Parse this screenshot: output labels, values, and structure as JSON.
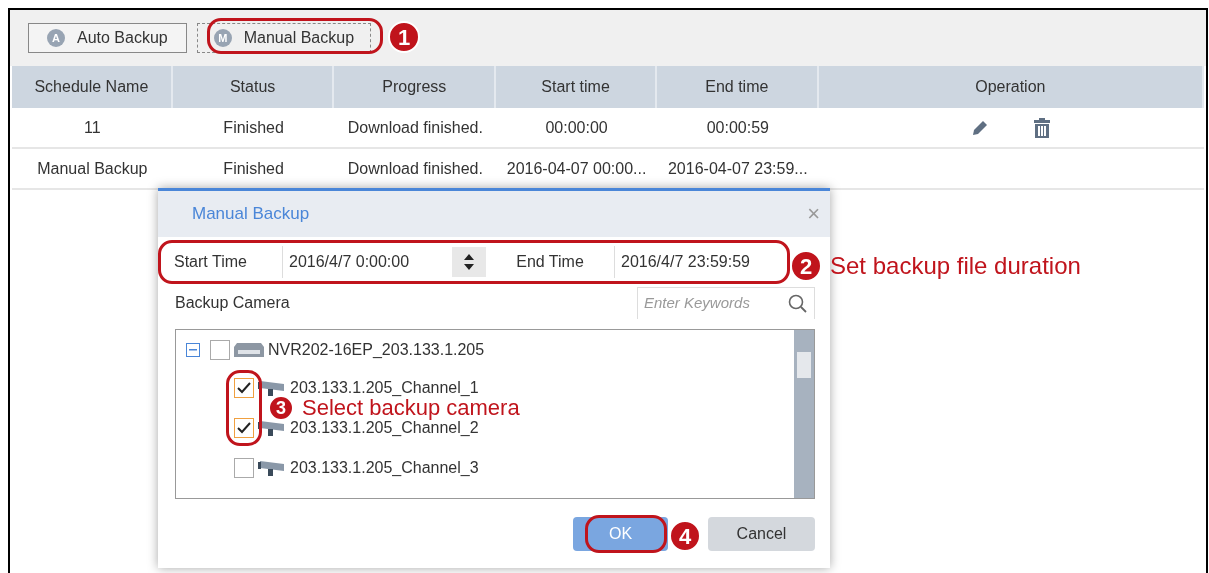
{
  "toolbar": [
    {
      "label": "Auto Backup",
      "badge": "A",
      "selected": false
    },
    {
      "label": "Manual Backup",
      "badge": "M",
      "selected": true
    }
  ],
  "table": {
    "columns": [
      "Schedule Name",
      "Status",
      "Progress",
      "Start time",
      "End time",
      "Operation"
    ],
    "rows": [
      {
        "cells": [
          "11",
          "Finished",
          "Download finished.",
          "00:00:00",
          "00:00:59"
        ],
        "actions": true
      },
      {
        "cells": [
          "Manual Backup",
          "Finished",
          "Download finished.",
          "2016-04-07 00:00...",
          "2016-04-07 23:59..."
        ],
        "actions": false
      }
    ]
  },
  "dialog": {
    "title": "Manual Backup",
    "close": "×",
    "start_label": "Start Time",
    "start_value": "2016/4/7 0:00:00",
    "end_label": "End Time",
    "end_value": "2016/4/7 23:59:59",
    "camera_label": "Backup Camera",
    "search": {
      "placeholder": "Enter Keywords"
    },
    "tree": [
      {
        "label": "NVR202-16EP_203.133.1.205",
        "expanded": true,
        "checked": false,
        "children": [
          {
            "label": "203.133.1.205_Channel_1",
            "checked": true
          },
          {
            "label": "203.133.1.205_Channel_2",
            "checked": true
          },
          {
            "label": "203.133.1.205_Channel_3",
            "checked": false
          }
        ]
      }
    ],
    "buttons": [
      {
        "label": "OK",
        "kind": "primary"
      },
      {
        "label": "Cancel",
        "kind": "secondary"
      }
    ]
  },
  "annotations": [
    {
      "number": "1"
    },
    {
      "number": "2",
      "text": "Set backup file duration"
    },
    {
      "number": "3",
      "text": "Select backup camera"
    },
    {
      "number": "4"
    }
  ]
}
